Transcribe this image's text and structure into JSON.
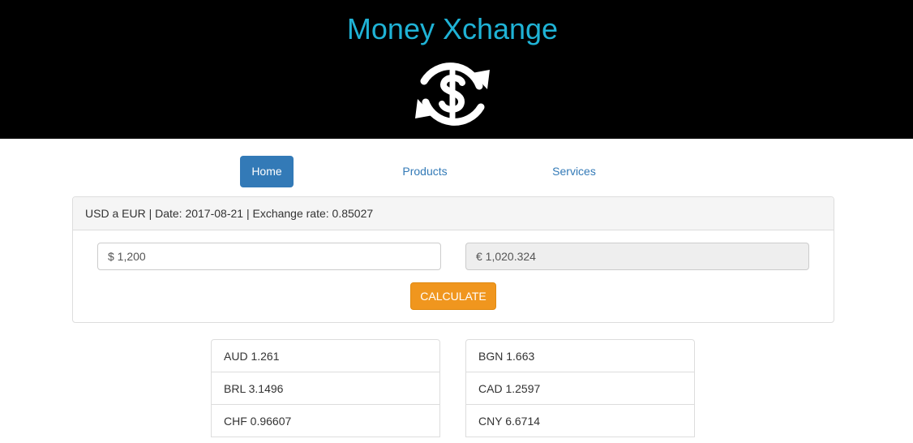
{
  "header": {
    "title": "Money Xchange",
    "logo_icon": "dollar-exchange-icon",
    "title_color": "#1fb3d6"
  },
  "nav": {
    "items": [
      {
        "label": "Home",
        "active": true
      },
      {
        "label": "Products",
        "active": false
      },
      {
        "label": "Services",
        "active": false
      }
    ]
  },
  "converter": {
    "heading": "USD a EUR | Date: 2017-08-21 | Exchange rate: 0.85027",
    "amount_value": "$ 1,200",
    "result_value": "€ 1,020.324",
    "calculate_label": "CALCULATE",
    "button_color": "#f0961e"
  },
  "rates": {
    "left": [
      "AUD 1.261",
      "BRL 3.1496",
      "CHF 0.96607"
    ],
    "right": [
      "BGN 1.663",
      "CAD 1.2597",
      "CNY 6.6714"
    ]
  }
}
